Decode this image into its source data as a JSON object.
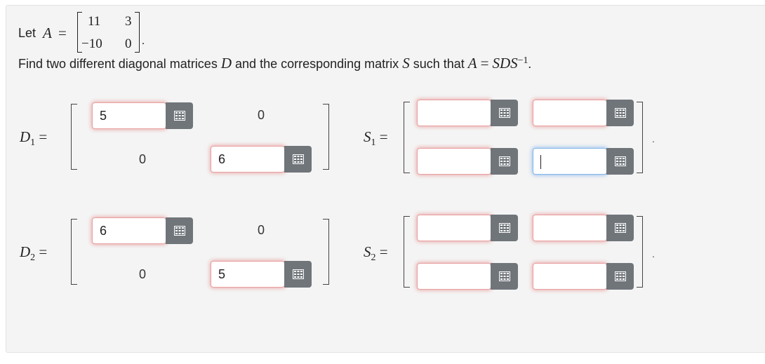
{
  "intro": {
    "let_label": "Let"
  },
  "matrix_A": {
    "symbol": "A",
    "row1": [
      "11",
      "3"
    ],
    "row2": [
      "−10",
      "0"
    ]
  },
  "instruction": {
    "text_before_D": "Find two different diagonal matrices",
    "D": "D",
    "text_middle": "and the corresponding matrix",
    "S": "S",
    "text_after_S": "such that",
    "equation_lhs": "A",
    "equation_rhs": "SDS",
    "exponent": "−1",
    "period": "."
  },
  "D1": {
    "symbol": "D",
    "subscript": "1",
    "entries": {
      "r1c1": "5",
      "r1c2": "0",
      "r2c1": "0",
      "r2c2": "6"
    }
  },
  "D2": {
    "symbol": "D",
    "subscript": "2",
    "entries": {
      "r1c1": "6",
      "r1c2": "0",
      "r2c1": "0",
      "r2c2": "5"
    }
  },
  "S1": {
    "symbol": "S",
    "subscript": "1",
    "entries": [
      "",
      "",
      "",
      ""
    ],
    "focused_index": 3
  },
  "S2": {
    "symbol": "S",
    "subscript": "2",
    "entries": [
      "",
      "",
      "",
      ""
    ]
  },
  "equals": "=",
  "trailing_dot": ".",
  "icons": {
    "input_button": "matrix-grid-icon"
  },
  "colors": {
    "error_glow": "#e15050",
    "focus_glow": "#5096e6",
    "button_bg": "#70757a"
  }
}
